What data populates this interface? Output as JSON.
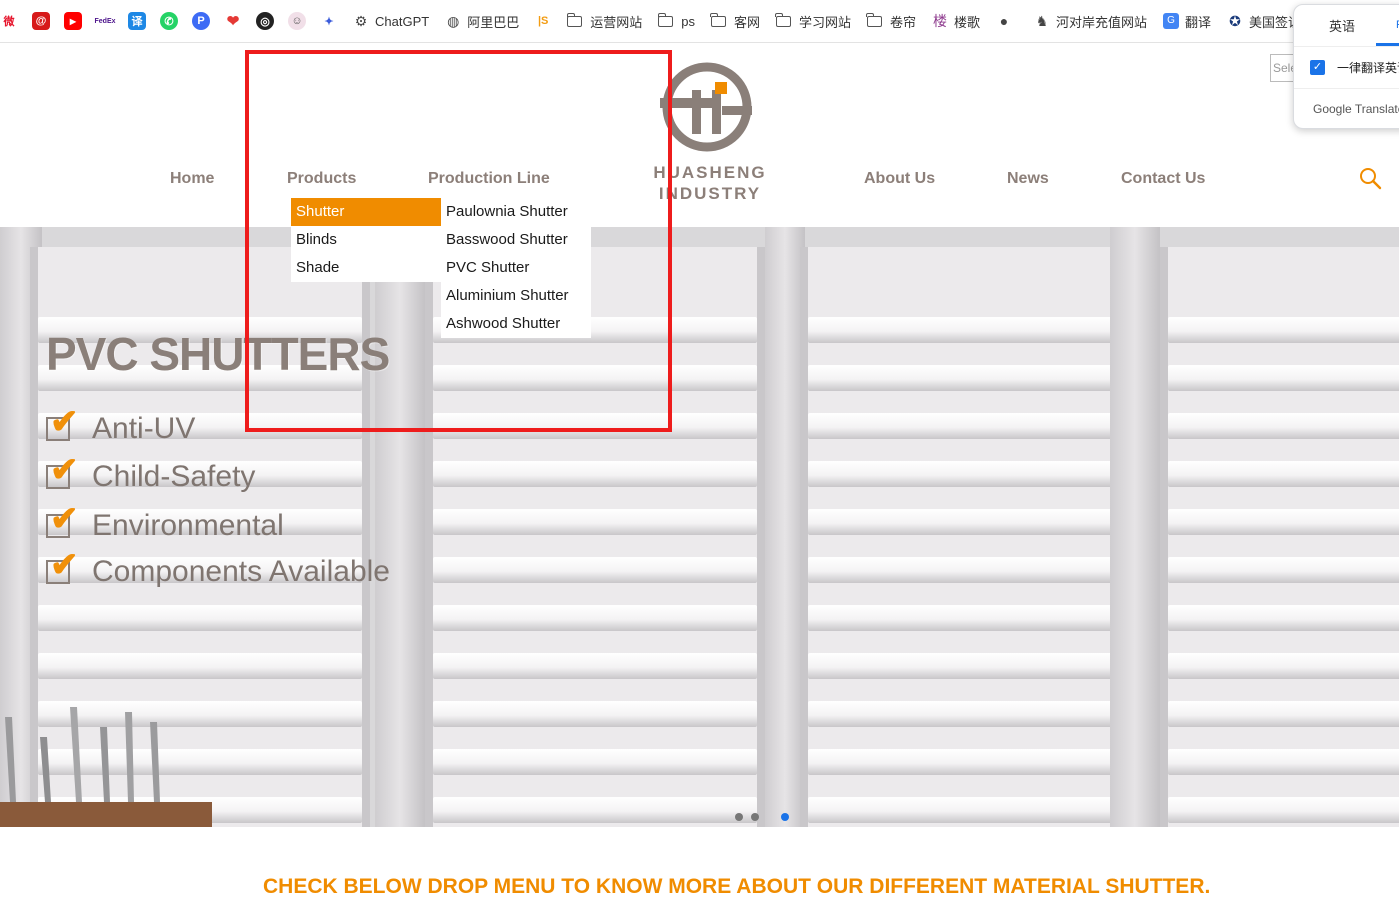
{
  "bookmarks": {
    "items": [
      {
        "label": "ChatGPT",
        "icon": "chatgpt-icon"
      },
      {
        "label": "阿里巴巴",
        "icon": "globe-icon"
      },
      {
        "label": "运营网站",
        "icon": "folder-icon"
      },
      {
        "label": "ps",
        "icon": "folder-icon"
      },
      {
        "label": "客网",
        "icon": "folder-icon"
      },
      {
        "label": "学习网站",
        "icon": "folder-icon"
      },
      {
        "label": "卷帘",
        "icon": "folder-icon"
      },
      {
        "label": "楼歌",
        "icon": "site-icon"
      },
      {
        "label": "河对岸充值网站",
        "icon": "site-icon"
      },
      {
        "label": "翻译",
        "icon": "translate-icon"
      },
      {
        "label": "美国签证",
        "icon": "seal-icon"
      }
    ]
  },
  "translate_popup": {
    "tab_label": "英语",
    "tab2_label": "P",
    "checkbox_label": "一律翻译英语",
    "footer_label": "Google Translate",
    "select_placeholder": "Sele"
  },
  "nav": {
    "home": "Home",
    "products": "Products",
    "production_line": "Production Line",
    "about": "About Us",
    "news": "News",
    "contact": "Contact Us"
  },
  "logo": {
    "line1": "HUASHENG",
    "line2": "INDUSTRY"
  },
  "dropdown": {
    "categories": [
      "Shutter",
      "Blinds",
      "Shade"
    ],
    "active_category": "Shutter",
    "subitems": [
      "Paulownia Shutter",
      "Basswood Shutter",
      "PVC Shutter",
      "Aluminium Shutter",
      "Ashwood Shutter"
    ]
  },
  "hero": {
    "title": "PVC SHUTTERS",
    "features": [
      "Anti-UV",
      "Child-Safety",
      "Environmental",
      "Components Available"
    ]
  },
  "bottom_text": "CHECK BELOW DROP MENU TO KNOW MORE ABOUT OUR DIFFERENT MATERIAL SHUTTER.",
  "colors": {
    "accent": "#f08c00",
    "nav_text": "#8c7f79",
    "highlight_box": "#ee1c1c"
  }
}
